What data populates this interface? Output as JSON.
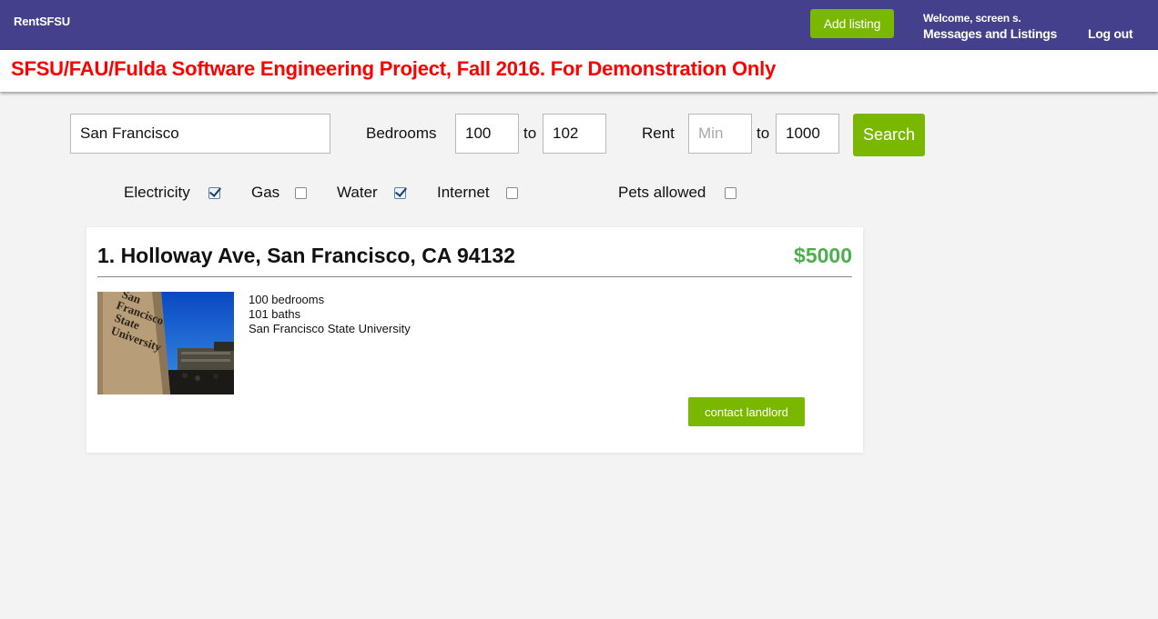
{
  "header": {
    "brand": "RentSFSU",
    "add_listing": "Add listing",
    "welcome": "Welcome, screen s.",
    "messages": "Messages and Listings",
    "logout": "Log out",
    "bg_color": "#45408c"
  },
  "banner": {
    "text": "SFSU/FAU/Fulda Software Engineering Project, Fall 2016. For Demonstration Only",
    "color": "#ff0000"
  },
  "search": {
    "location_value": "San Francisco",
    "bedrooms_label": "Bedrooms",
    "bedrooms_min": "100",
    "bedrooms_to": "to",
    "bedrooms_max": "102",
    "rent_label": "Rent",
    "rent_min_placeholder": "Min",
    "rent_to": "to",
    "rent_max": "1000",
    "search_button": "Search"
  },
  "filters": [
    {
      "label": "Electricity",
      "checked": true
    },
    {
      "label": "Gas",
      "checked": false
    },
    {
      "label": "Water",
      "checked": true
    },
    {
      "label": "Internet",
      "checked": false
    },
    {
      "label": "Pets allowed",
      "checked": false
    }
  ],
  "listings": [
    {
      "title": "1. Holloway Ave, San Francisco, CA 94132",
      "price": "$5000",
      "details": [
        "100 bedrooms",
        "101 baths",
        "San Francisco State University"
      ],
      "photo_sign_lines": [
        "San",
        "Francisco",
        "State",
        "University"
      ],
      "contact_button": "contact landlord"
    }
  ],
  "accent_color": "#7ab800",
  "price_color": "#4cae4c"
}
